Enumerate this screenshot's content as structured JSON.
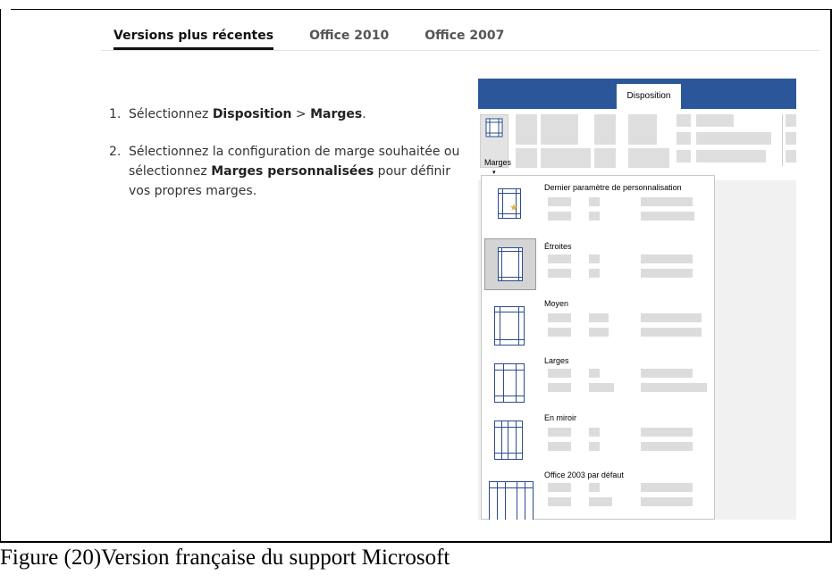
{
  "tabs": [
    {
      "label": "Versions plus récentes",
      "active": true
    },
    {
      "label": "Office 2010",
      "active": false
    },
    {
      "label": "Office 2007",
      "active": false
    }
  ],
  "steps": [
    {
      "num": "1.",
      "text1": "Sélectionnez ",
      "bold1": "Disposition",
      "text2": " > ",
      "bold2": "Marges",
      "text3": "."
    },
    {
      "num": "2.",
      "text1": "Sélectionnez la configuration de marge souhaitée ou sélectionnez ",
      "bold1": "Marges personnalisées",
      "text2": " pour définir vos propres marges."
    }
  ],
  "word": {
    "tab_disposition": "Disposition",
    "marges_button": "Marges",
    "menu_items": [
      {
        "title": "Dernier paramètre de personnalisation",
        "icon": "star-icon",
        "selected": false
      },
      {
        "title": "Étroites",
        "selected": true
      },
      {
        "title": "Moyen",
        "selected": false
      },
      {
        "title": "Larges",
        "selected": false
      },
      {
        "title": "En miroir",
        "selected": false
      },
      {
        "title": "Office 2003 par défaut",
        "selected": false
      }
    ]
  },
  "caption": "Figure (20)Version française du support Microsoft",
  "colors": {
    "ribbon": "#2b579a",
    "margin_line": "#2b4c8c",
    "star": "#e3b341"
  }
}
